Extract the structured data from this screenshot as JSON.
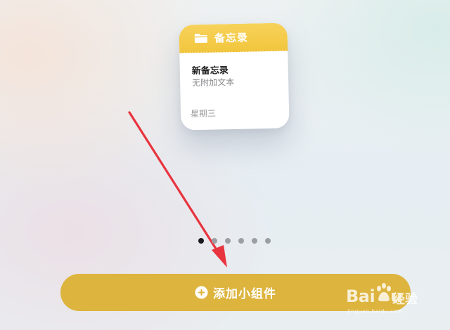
{
  "widget": {
    "app_name": "备忘录",
    "note_title": "新备忘录",
    "note_subtitle": "无附加文本",
    "note_date": "星期三",
    "header_color": "#f4c94a",
    "icon": "folder-icon"
  },
  "pagination": {
    "total": 6,
    "active_index": 0
  },
  "add_button": {
    "label": "添加小组件",
    "icon": "plus-circle-icon",
    "color": "#ddb43d"
  },
  "annotation": {
    "color": "#e8343f"
  },
  "watermark": {
    "brand_left": "Bai",
    "brand_right": "u",
    "brand_suffix": "经验",
    "url": "jingyan.baidu.com"
  }
}
